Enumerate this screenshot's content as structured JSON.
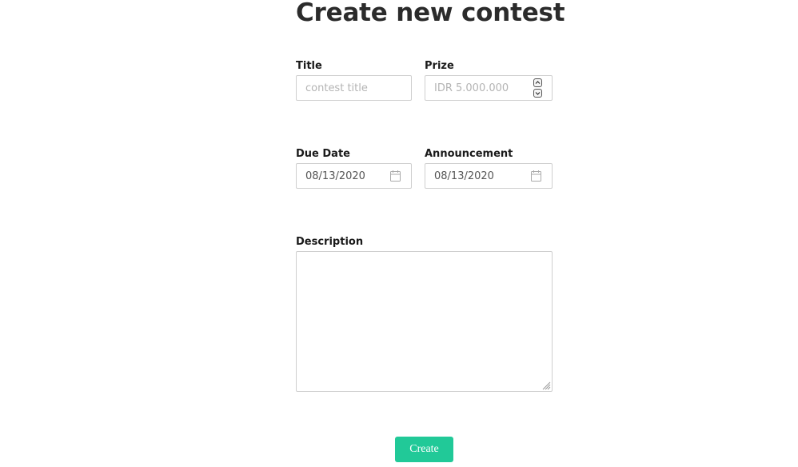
{
  "page": {
    "title": "Create new contest"
  },
  "form": {
    "title": {
      "label": "Title",
      "placeholder": "contest title",
      "value": ""
    },
    "prize": {
      "label": "Prize",
      "placeholder": "IDR 5.000.000",
      "value": ""
    },
    "due_date": {
      "label": "Due Date",
      "value": "08/13/2020"
    },
    "announcement": {
      "label": "Announcement",
      "value": "08/13/2020"
    },
    "description": {
      "label": "Description",
      "value": ""
    },
    "submit_label": "Create"
  },
  "icons": {
    "date_picker": "calendar-icon",
    "number_stepper": "stepper-arrows-icon",
    "resize": "resize-grip-icon"
  },
  "colors": {
    "primary_button": "#21c998",
    "border": "#cfcfcf",
    "placeholder": "#b4b4b4"
  }
}
